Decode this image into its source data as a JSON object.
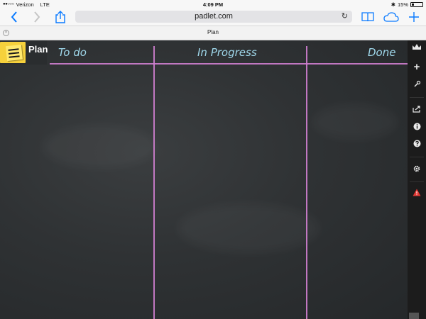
{
  "status": {
    "carrier": "Verizon",
    "network": "LTE",
    "time": "4:09 PM",
    "battery": "15%"
  },
  "browser": {
    "url": "padlet.com",
    "tab_title": "Plan"
  },
  "board": {
    "title": "Plan",
    "columns": [
      "To do",
      "In Progress",
      "Done"
    ]
  },
  "icons": {
    "back": "chevron-left-icon",
    "forward": "chevron-right-icon",
    "share": "share-icon",
    "reload": "reload-icon",
    "bookmarks": "book-icon",
    "cloud": "cloud-icon",
    "new_tab": "plus-icon",
    "sidebar": [
      "crown-icon",
      "plus-icon",
      "wrench-icon",
      "share-out-icon",
      "info-icon",
      "help-icon",
      "gear-icon",
      "warning-icon"
    ]
  },
  "colors": {
    "accent": "#0a7aff",
    "chalk_line": "#d27fd2",
    "chalk_text": "#9fd7ea",
    "warning": "#e53935"
  }
}
